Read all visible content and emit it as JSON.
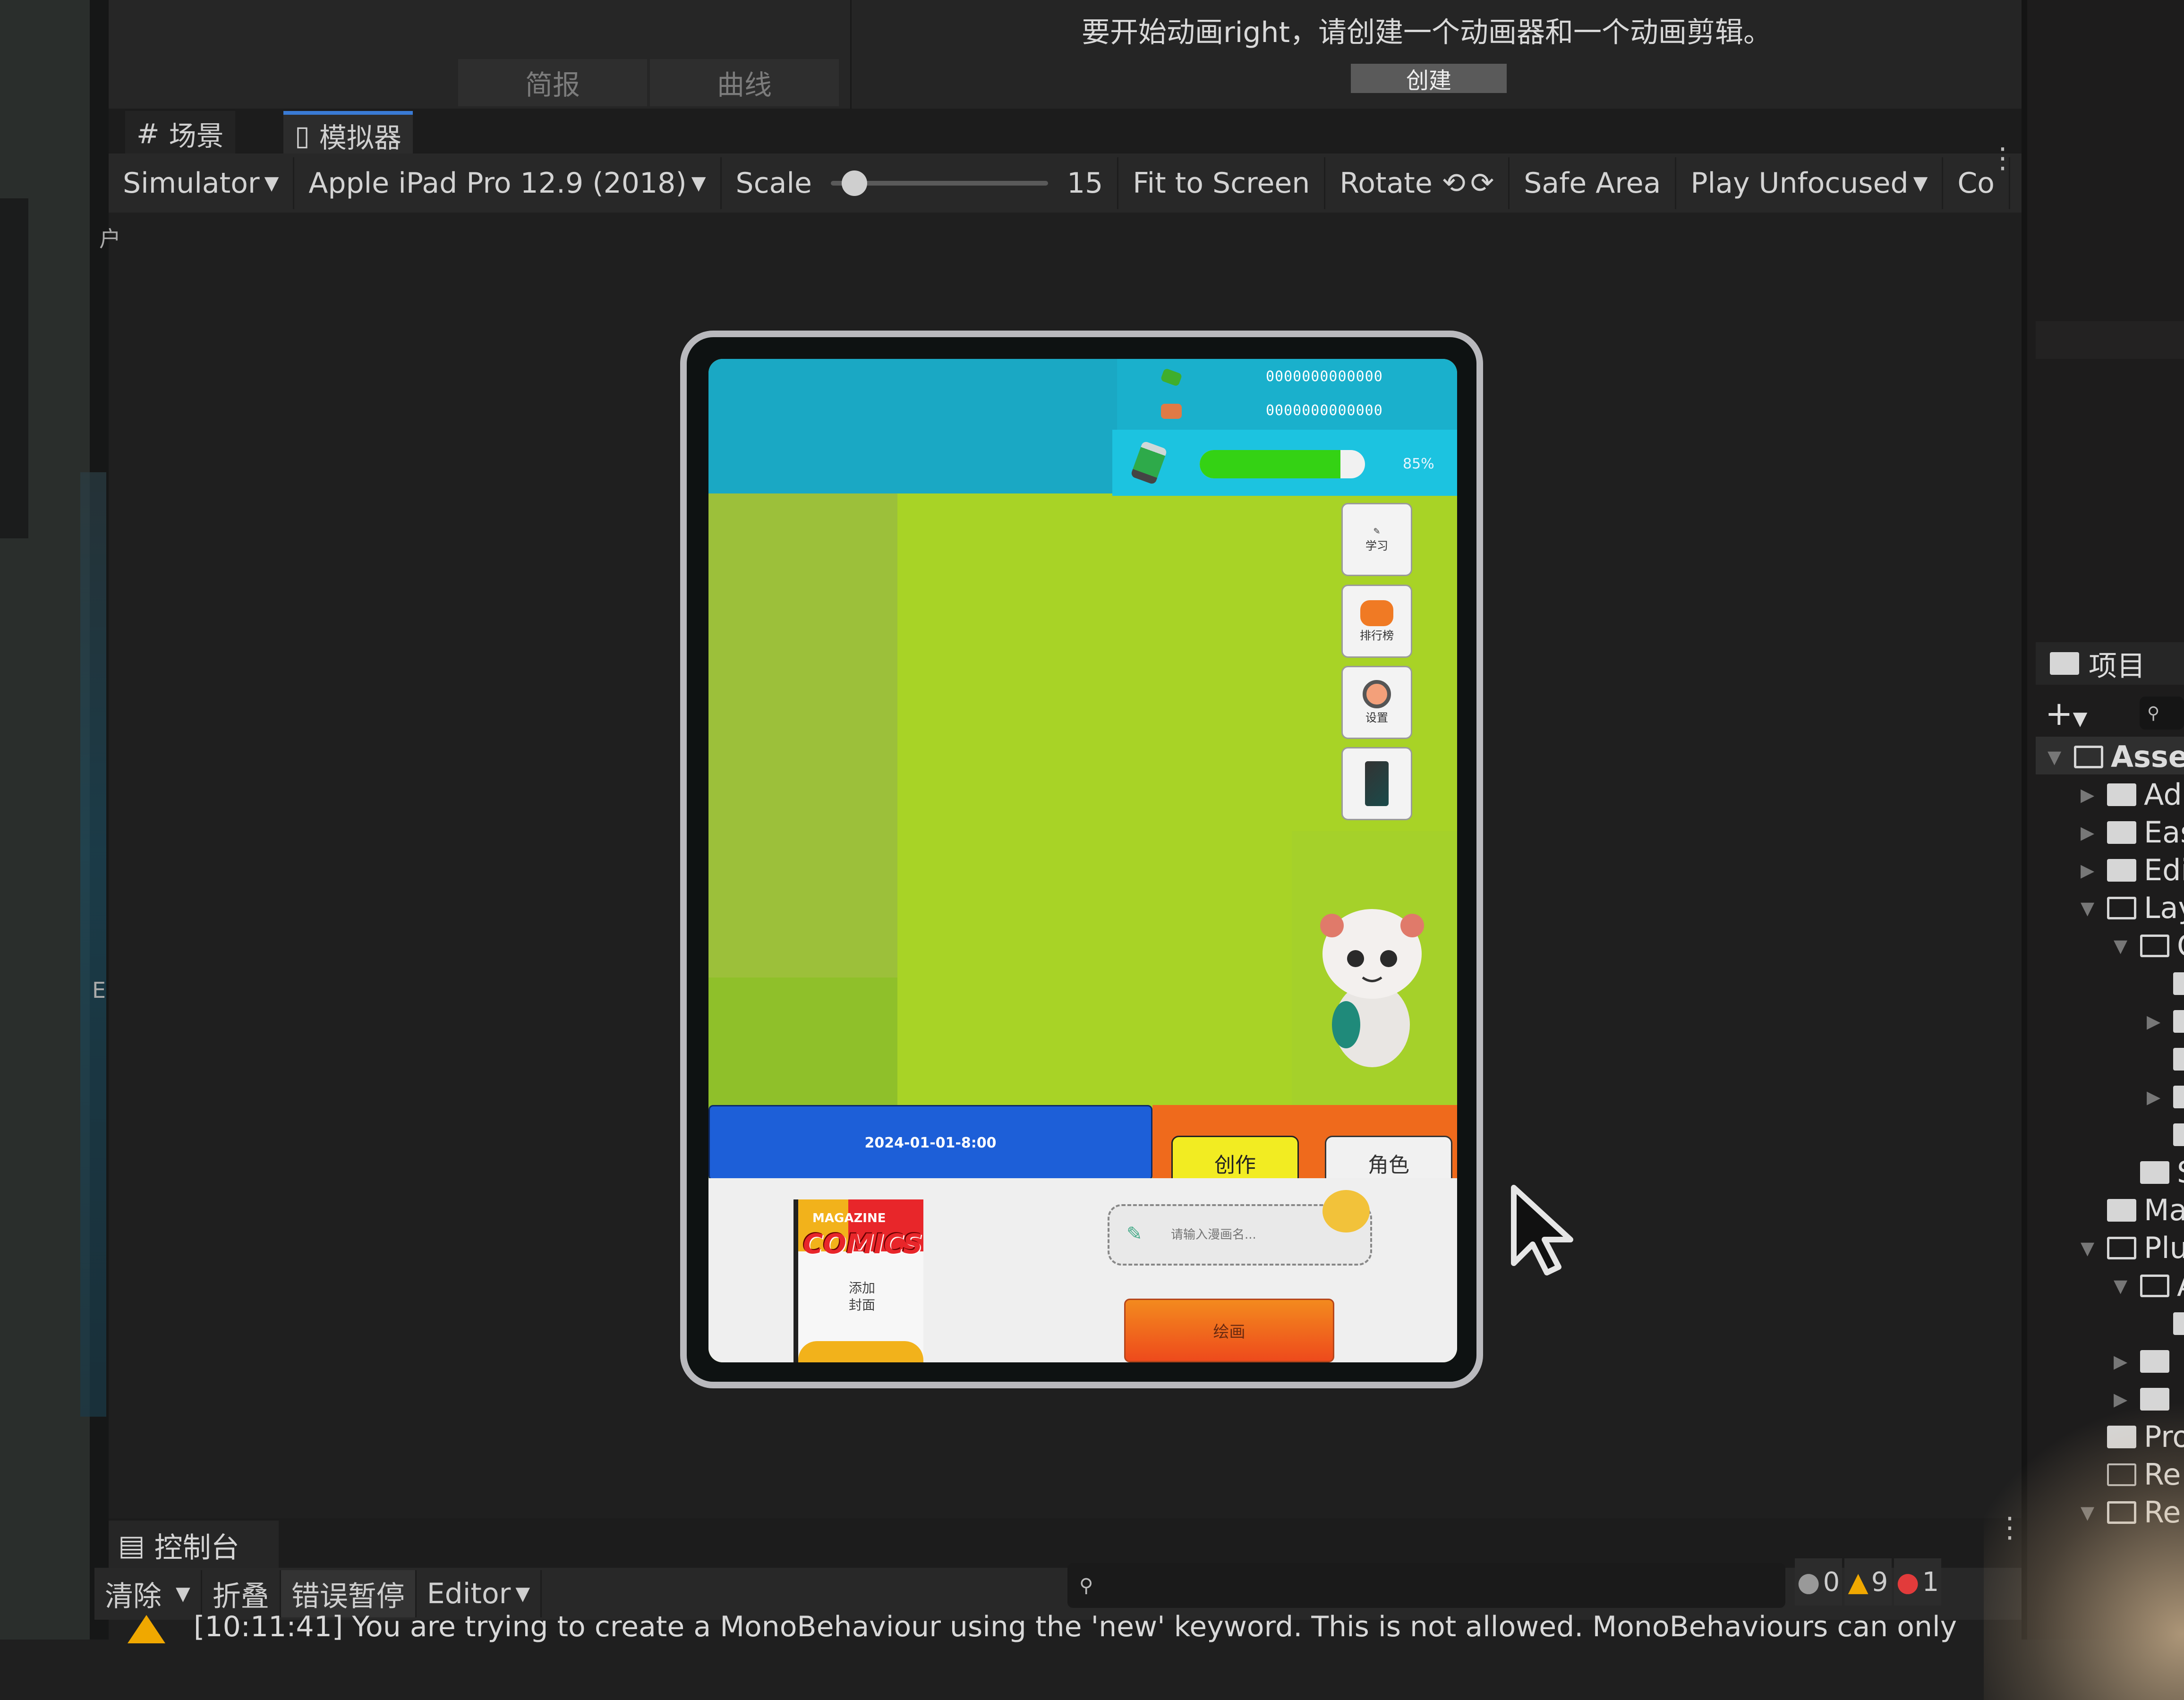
{
  "top_tabs": [
    "简报",
    "曲线"
  ],
  "animation_panel": {
    "message": "要开始动画right，请创建一个动画器和一个动画剪辑。",
    "create_button": "创建"
  },
  "view_tabs": {
    "scene": {
      "icon": "grid-icon",
      "label": "场景"
    },
    "simulator": {
      "icon": "device-icon",
      "label": "模拟器"
    }
  },
  "toolbar": {
    "mode": "Simulator",
    "device": "Apple iPad Pro 12.9 (2018)",
    "scale_label": "Scale",
    "scale_value": "15",
    "scale_slider_fraction": 0.05,
    "fit_to_screen": "Fit to Screen",
    "rotate": "Rotate",
    "safe_area": "Safe Area",
    "play_mode": "Play Unfocused",
    "control_truncated": "Co"
  },
  "viewport_side_glyphs": [
    "户",
    "E"
  ],
  "game": {
    "hud": {
      "gem_value": "0000000000000",
      "coin_value": "0000000000000",
      "energy_percent": 85,
      "energy_text": "85%"
    },
    "side_buttons": [
      {
        "label": "学习",
        "icon": "study-icon"
      },
      {
        "label": "排行榜",
        "icon": "leaderboard-icon"
      },
      {
        "label": "设置",
        "icon": "settings-gear-icon"
      },
      {
        "label": "",
        "icon": "phone-icon"
      }
    ],
    "date_text": "2024-01-01-8:00",
    "create_button": "创作",
    "role_button": "角色",
    "cover": {
      "magazine": "MAGAZINE",
      "comics": "COMICS",
      "add_cover_label": "添加封面"
    },
    "name_input_placeholder": "请输入漫画名...",
    "draw_button": "绘画"
  },
  "console": {
    "tab_label": "控制台",
    "clear": "清除",
    "collapse": "折叠",
    "error_pause": "错误暂停",
    "editor": "Editor",
    "info_count": "0",
    "warning_count": "9",
    "error_count": "1",
    "log_line": "[10:11:41] You are trying to create a MonoBehaviour using the 'new' keyword.  This is not allowed.  MonoBehaviours can only"
  },
  "project_panel": {
    "tab_label": "项目",
    "tree": [
      {
        "label": "Assets",
        "state": "open",
        "depth": 0
      },
      {
        "label": "Ad",
        "state": "closed",
        "depth": 1
      },
      {
        "label": "Eas",
        "state": "closed",
        "depth": 1
      },
      {
        "label": "Edi",
        "state": "closed",
        "depth": 1
      },
      {
        "label": "Lay",
        "state": "open",
        "depth": 1
      },
      {
        "label": "C",
        "state": "open",
        "depth": 2
      },
      {
        "label": "",
        "state": "leaf",
        "depth": 3
      },
      {
        "label": "",
        "state": "closed",
        "depth": 3
      },
      {
        "label": "",
        "state": "leaf",
        "depth": 3
      },
      {
        "label": "",
        "state": "closed",
        "depth": 3
      },
      {
        "label": "",
        "state": "leaf",
        "depth": 3
      },
      {
        "label": "S",
        "state": "leaf",
        "depth": 2
      },
      {
        "label": "Ma",
        "state": "leaf",
        "depth": 1
      },
      {
        "label": "Plu",
        "state": "open",
        "depth": 1
      },
      {
        "label": "A",
        "state": "open",
        "depth": 2
      },
      {
        "label": "",
        "state": "leaf",
        "depth": 3
      },
      {
        "label": "",
        "state": "closed",
        "depth": 2
      },
      {
        "label": "",
        "state": "closed",
        "depth": 2
      },
      {
        "label": "Pro",
        "state": "leaf",
        "depth": 1
      },
      {
        "label": "Re",
        "state": "empty",
        "depth": 1
      },
      {
        "label": "Re",
        "state": "open",
        "depth": 1
      }
    ]
  }
}
